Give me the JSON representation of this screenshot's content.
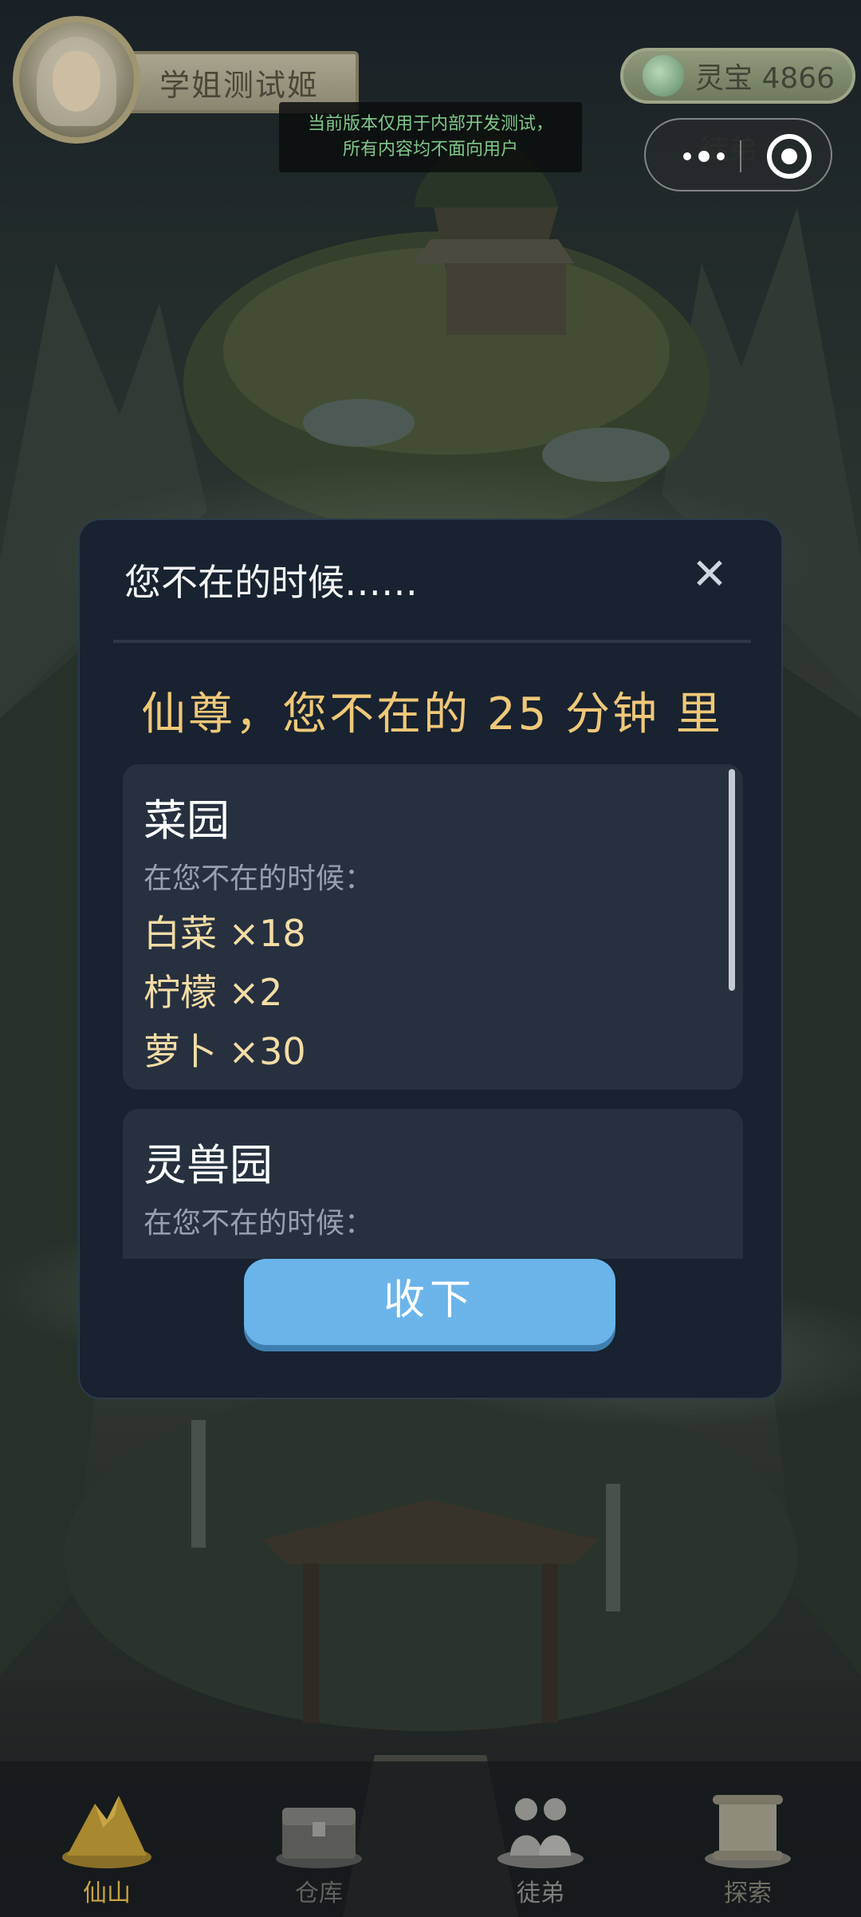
{
  "player": {
    "name": "学姐测试姬"
  },
  "currency": {
    "label": "灵宝 4866",
    "icon": "jade-icon"
  },
  "dev_notice": {
    "line1": "当前版本仅用于内部开发测试，",
    "line2": "所有内容均不面向用户"
  },
  "header_partial": {
    "label": "徒弟"
  },
  "mini_program_menu": {
    "more_icon": "more-dots-icon",
    "close_icon": "target-close-icon"
  },
  "modal": {
    "title": "您不在的时候……",
    "close_symbol": "✕",
    "headline": "仙尊，您不在的 25 分钟 里",
    "sections": [
      {
        "title": "菜园",
        "subtitle": "在您不在的时候：",
        "items": [
          "白菜 ×18",
          "柠檬 ×2",
          "萝卜 ×30"
        ]
      },
      {
        "title": "灵兽园",
        "subtitle": "在您不在的时候："
      }
    ],
    "accept_label": "收下"
  },
  "bottom_nav": [
    {
      "label": "仙山",
      "icon": "mountain-icon",
      "active": true
    },
    {
      "label": "仓库",
      "icon": "chest-icon",
      "active": false
    },
    {
      "label": "徒弟",
      "icon": "disciples-icon",
      "active": false
    },
    {
      "label": "探索",
      "icon": "scroll-icon",
      "active": false
    }
  ],
  "colors": {
    "accent_gold": "#efc878",
    "button_blue": "#6bb4ea",
    "modal_bg": "#182230"
  }
}
